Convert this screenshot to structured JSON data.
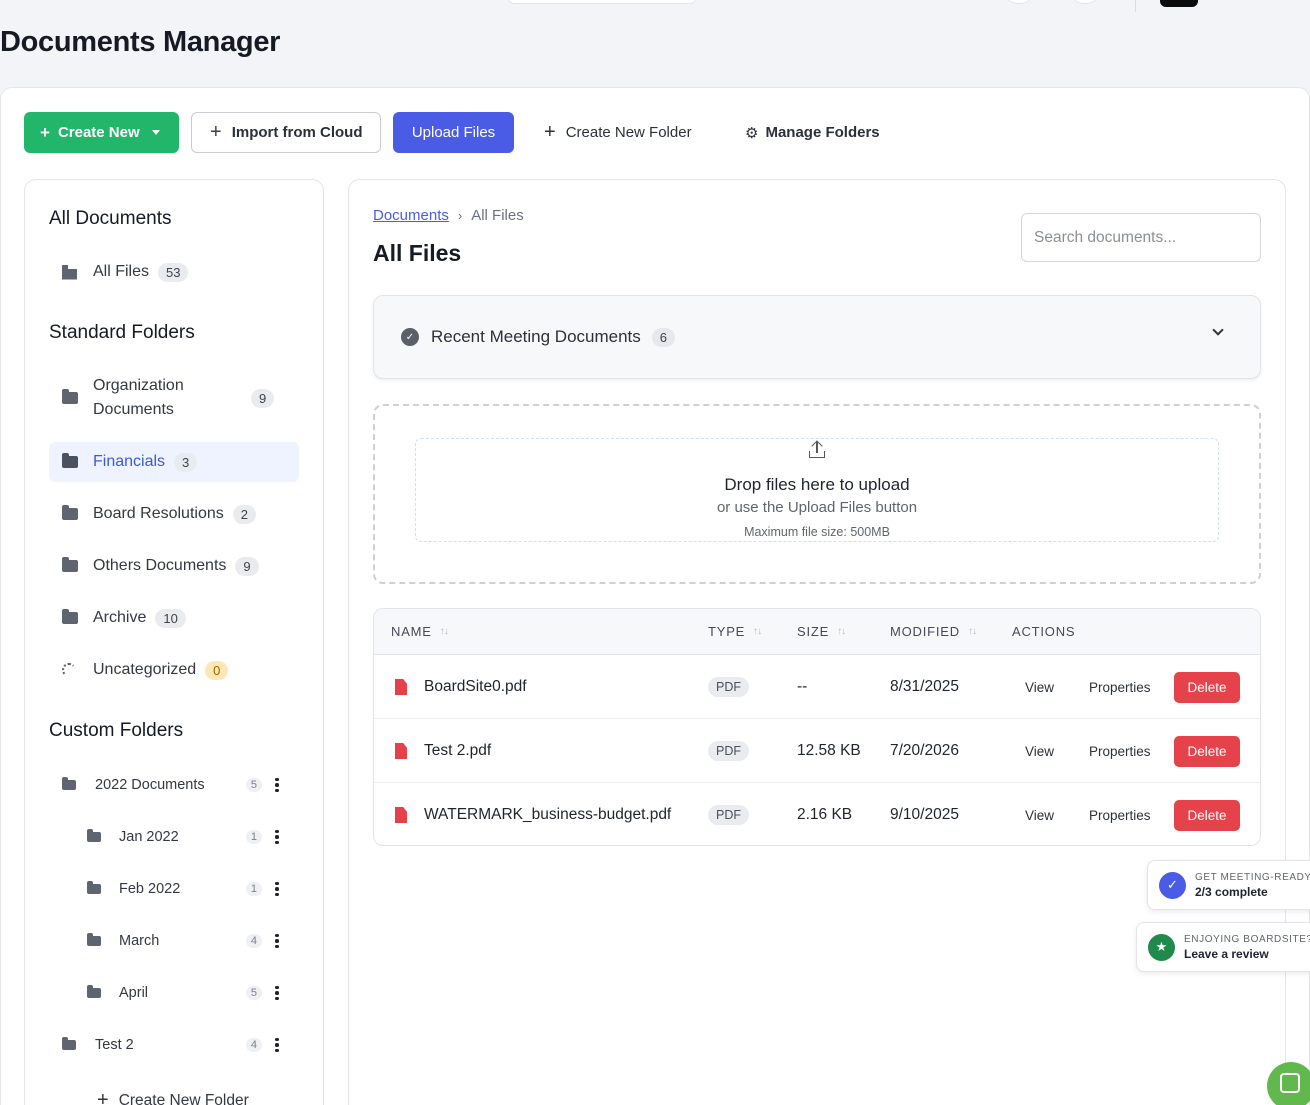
{
  "page": {
    "title": "Documents Manager"
  },
  "toolbar": {
    "create_new": "Create New",
    "import_cloud": "Import from Cloud",
    "upload_files": "Upload Files",
    "create_folder": "Create New Folder",
    "manage_folders": "Manage Folders"
  },
  "sidebar": {
    "all_documents_heading": "All Documents",
    "all_files": {
      "label": "All Files",
      "count": "53"
    },
    "standard_heading": "Standard Folders",
    "standard": [
      {
        "label": "Organization Documents",
        "count": "9"
      },
      {
        "label": "Financials",
        "count": "3",
        "active": true
      },
      {
        "label": "Board Resolutions",
        "count": "2"
      },
      {
        "label": "Others Documents",
        "count": "9"
      },
      {
        "label": "Archive",
        "count": "10"
      },
      {
        "label": "Uncategorized",
        "count": "0"
      }
    ],
    "custom_heading": "Custom Folders",
    "custom": [
      {
        "label": "2022 Documents",
        "count": "5"
      },
      {
        "label": "Jan 2022",
        "count": "1"
      },
      {
        "label": "Feb 2022",
        "count": "1"
      },
      {
        "label": "March",
        "count": "4"
      },
      {
        "label": "April",
        "count": "5"
      },
      {
        "label": "Test 2",
        "count": "4"
      }
    ],
    "create_folder": "Create New Folder"
  },
  "content": {
    "breadcrumb": {
      "root": "Documents",
      "separator": "›",
      "current": "All Files"
    },
    "title": "All Files",
    "search_placeholder": "Search documents...",
    "meeting": {
      "label": "Recent Meeting Documents",
      "count": "6"
    },
    "dropzone": {
      "title": "Drop files here to upload",
      "subtitle": "or use the Upload Files button",
      "max_size": "Maximum file size: 500MB"
    },
    "table": {
      "columns": [
        "NAME",
        "TYPE",
        "SIZE",
        "MODIFIED",
        "ACTIONS"
      ],
      "rows": [
        {
          "name": "BoardSite0.pdf",
          "type": "PDF",
          "size": "--",
          "modified": "8/31/2025"
        },
        {
          "name": "Test 2.pdf",
          "type": "PDF",
          "size": "12.58 KB",
          "modified": "7/20/2026"
        },
        {
          "name": "WATERMARK_business-budget.pdf",
          "type": "PDF",
          "size": "2.16 KB",
          "modified": "9/10/2025"
        }
      ],
      "actions": {
        "view": "View",
        "properties": "Properties",
        "delete": "Delete"
      }
    }
  },
  "toasts": {
    "meeting_ready": {
      "title": "GET MEETING-READY",
      "body": "2/3 complete"
    },
    "review": {
      "title": "ENJOYING BOARDSITE?",
      "body": "Leave a review"
    }
  },
  "colors": {
    "accent_blue": "#4a5ce6",
    "create_green": "#22b66b",
    "delete_red": "#e6424b",
    "pdf_red": "#e5414b"
  }
}
